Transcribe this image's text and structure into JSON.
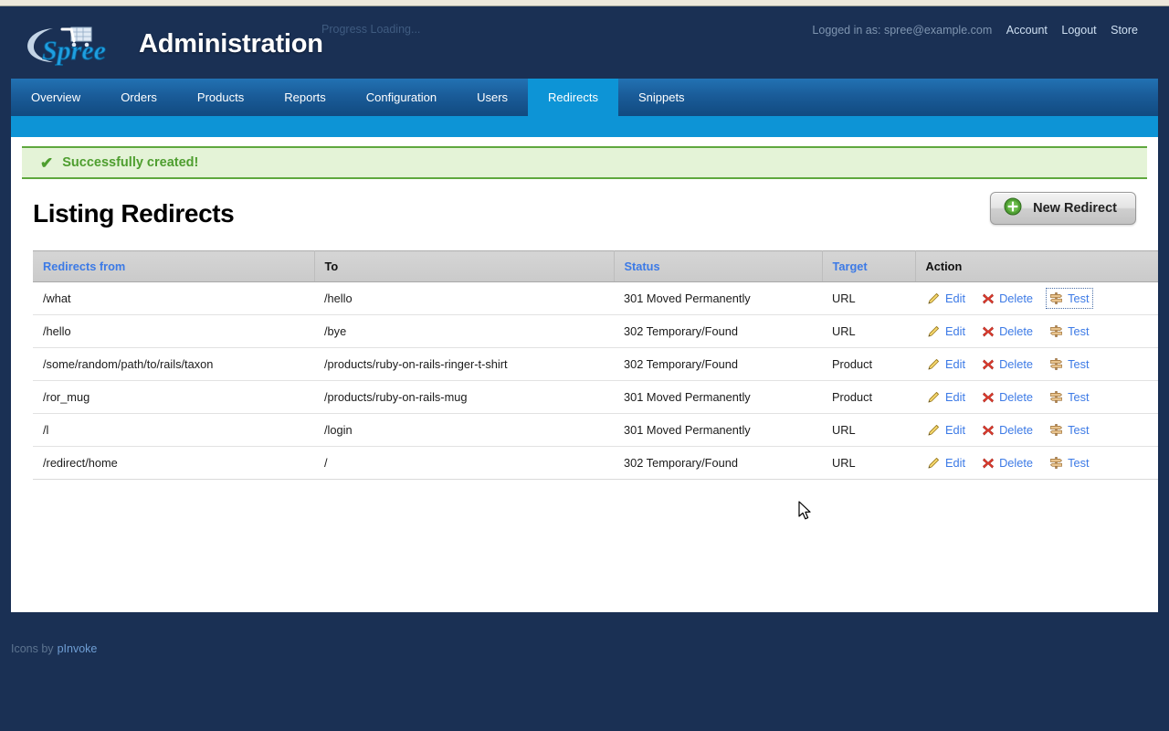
{
  "header": {
    "app_title": "Administration",
    "logo_text": "Spree",
    "progress_text": "Progress Loading...",
    "logged_in_label": "Logged in as: spree@example.com",
    "links": [
      {
        "label": "Account",
        "name": "account-link"
      },
      {
        "label": "Logout",
        "name": "logout-link"
      },
      {
        "label": "Store",
        "name": "store-link"
      }
    ]
  },
  "nav": {
    "tabs": [
      {
        "label": "Overview",
        "active": false
      },
      {
        "label": "Orders",
        "active": false
      },
      {
        "label": "Products",
        "active": false
      },
      {
        "label": "Reports",
        "active": false
      },
      {
        "label": "Configuration",
        "active": false
      },
      {
        "label": "Users",
        "active": false
      },
      {
        "label": "Redirects",
        "active": true
      },
      {
        "label": "Snippets",
        "active": false
      }
    ]
  },
  "flash": {
    "icon": "check-icon",
    "message": "Successfully created!"
  },
  "page": {
    "title": "Listing Redirects",
    "new_button_label": "New Redirect",
    "new_button_icon": "plus-circle-icon"
  },
  "table": {
    "columns": [
      {
        "label": "Redirects from",
        "sortable": true
      },
      {
        "label": "To",
        "sortable": false
      },
      {
        "label": "Status",
        "sortable": true
      },
      {
        "label": "Target",
        "sortable": true
      },
      {
        "label": "Action",
        "sortable": false
      }
    ],
    "action_labels": {
      "edit": "Edit",
      "delete": "Delete",
      "test": "Test"
    },
    "rows": [
      {
        "from": "/what",
        "to": "/hello",
        "status": "301 Moved Permanently",
        "target": "URL",
        "test_focused": true
      },
      {
        "from": "/hello",
        "to": "/bye",
        "status": "302 Temporary/Found",
        "target": "URL",
        "test_focused": false
      },
      {
        "from": "/some/random/path/to/rails/taxon",
        "to": "/products/ruby-on-rails-ringer-t-shirt",
        "status": "302 Temporary/Found",
        "target": "Product",
        "test_focused": false
      },
      {
        "from": "/ror_mug",
        "to": "/products/ruby-on-rails-mug",
        "status": "301 Moved Permanently",
        "target": "Product",
        "test_focused": false
      },
      {
        "from": "/l",
        "to": "/login",
        "status": "301 Moved Permanently",
        "target": "URL",
        "test_focused": false
      },
      {
        "from": "/redirect/home",
        "to": "/",
        "status": "302 Temporary/Found",
        "target": "URL",
        "test_focused": false
      }
    ]
  },
  "footer": {
    "text": "Icons by",
    "link_label": "pInvoke"
  },
  "colors": {
    "header_bg": "#1a3054",
    "accent_blue": "#0d94d6",
    "tab_blue": "#1a5c99",
    "link_blue": "#3c7ae6",
    "success_green": "#4e9e2f",
    "success_bg": "#e4f3d7",
    "content_bg": "#ffffff"
  }
}
